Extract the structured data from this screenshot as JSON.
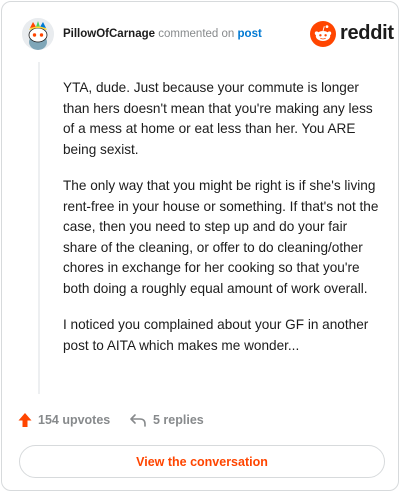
{
  "header": {
    "username": "PillowOfCarnage",
    "action_text": "commented on",
    "target_text": "post",
    "brand_name": "reddit"
  },
  "comment": {
    "paragraphs": [
      "YTA, dude. Just because your commute is longer than hers doesn't mean that you're making any less of a mess at home or eat less than her. You ARE being sexist.",
      "The only way that you might be right is if she's living rent-free in your house or something. If that's not the case, then you need to step up and do your fair share of the cleaning, or offer to do cleaning/other chores in exchange for her cooking so that you're both doing a roughly equal amount of work overall.",
      "I noticed you complained about your GF in another post to AITA which makes me wonder..."
    ]
  },
  "actions": {
    "upvotes": "154 upvotes",
    "replies": "5 replies"
  },
  "cta": {
    "label": "View the conversation"
  },
  "icons": {
    "avatar": "snoo-avatar-icon",
    "brand": "reddit-logo-icon",
    "upvote": "upvote-arrow-icon",
    "reply": "reply-arrow-icon"
  },
  "colors": {
    "brand_orange": "#ff4500",
    "link_blue": "#0079d3",
    "muted_gray": "#878a8c",
    "border": "#d7dadc"
  }
}
